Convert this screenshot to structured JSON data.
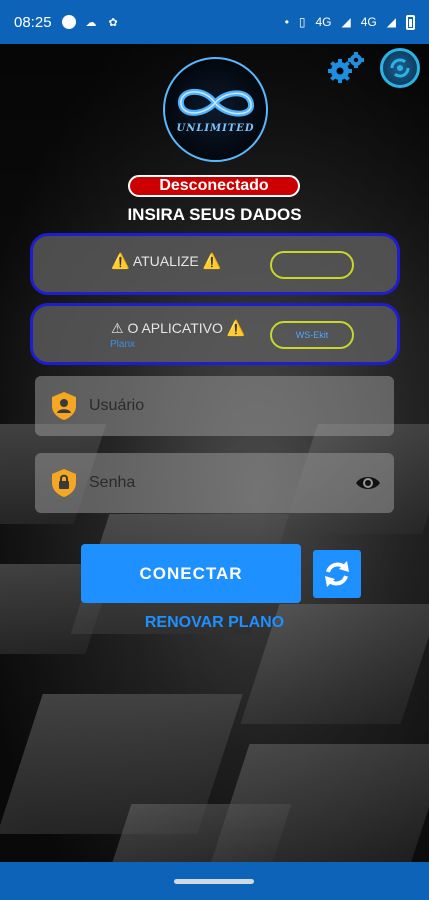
{
  "status_bar": {
    "time": "08:25",
    "signal_label_1": "4G",
    "signal_label_2": "4G"
  },
  "header": {
    "logo_text": "UNLIMITED",
    "settings_icon": "gear-icon",
    "sync_icon": "sync-icon"
  },
  "status": {
    "label": "Desconectado",
    "color": "#cc0000"
  },
  "subtitle": "INSIRA SEUS DADOS",
  "notices": [
    {
      "title": "ATUALIZE",
      "warn": "⚠️",
      "chip": "",
      "small": ""
    },
    {
      "title": "O APLICATIVO",
      "warn_left": "⚠",
      "warn": "⚠️",
      "chip": "WS-Ekit",
      "small": "Planx"
    }
  ],
  "form": {
    "username_placeholder": "Usuário",
    "password_placeholder": "Senha"
  },
  "actions": {
    "connect_label": "CONECTAR",
    "renew_label": "RENOVAR PLANO"
  },
  "colors": {
    "accent": "#1e90ff",
    "bars": "#0d63b8",
    "card_border": "#1e1ecf",
    "shield": "#f5a623"
  }
}
